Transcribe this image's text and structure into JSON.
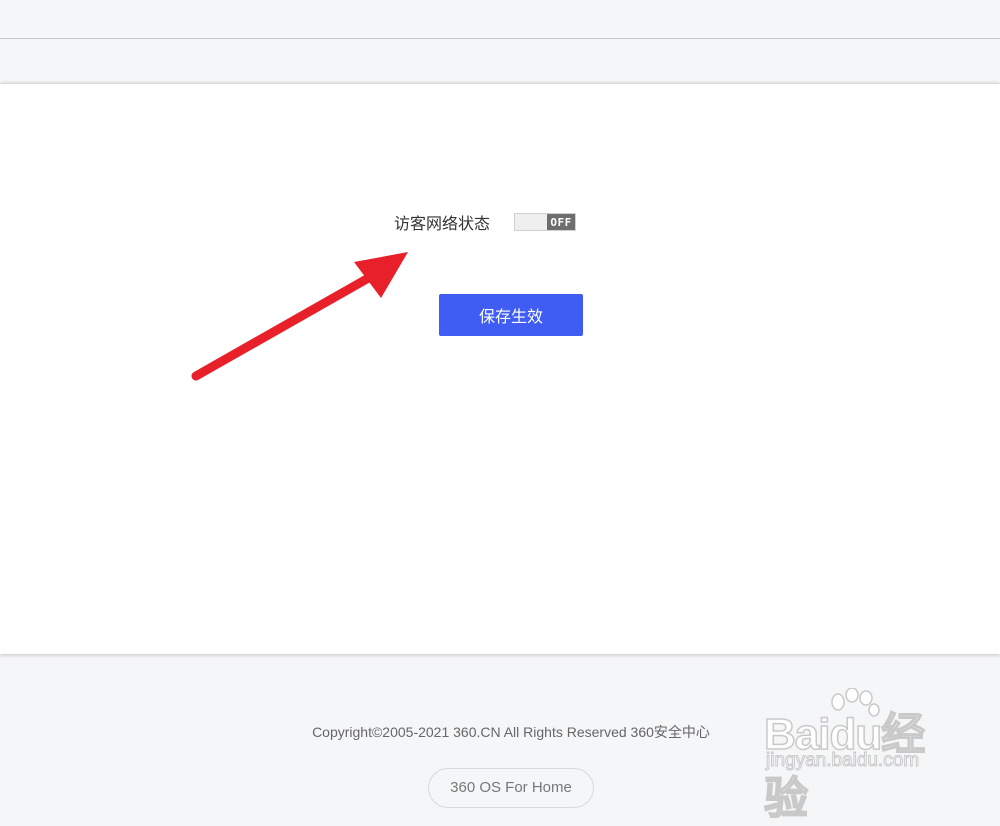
{
  "guest_network": {
    "label": "访客网络状态",
    "toggle_state": "OFF"
  },
  "save_button": {
    "label": "保存生效",
    "color": "#3f5df3"
  },
  "annotation": {
    "arrow_color": "#e8202a"
  },
  "footer": {
    "copyright": "Copyright©2005-2021 360.CN All Rights Reserved 360安全中心",
    "os_pill": "360 OS For Home"
  },
  "watermark": {
    "logo": "Baidu经验",
    "url": "jingyan.baidu.com"
  }
}
